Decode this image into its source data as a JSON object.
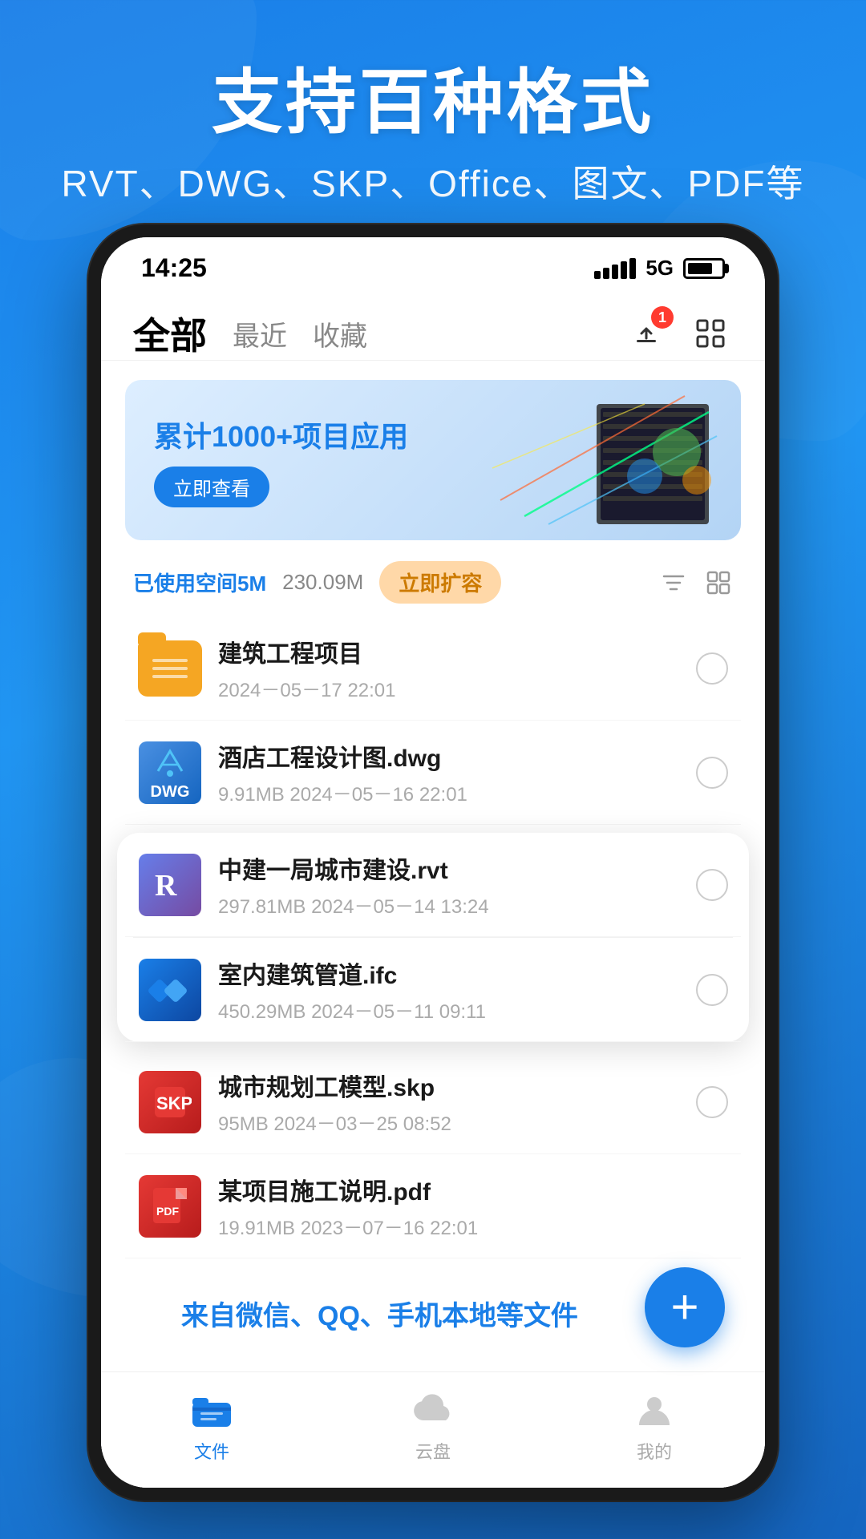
{
  "hero": {
    "title": "支持百种格式",
    "subtitle": "RVT、DWG、SKP、Office、图文、PDF等"
  },
  "status_bar": {
    "time": "14:25",
    "network": "5G",
    "badge_count": "1"
  },
  "nav_tabs": {
    "all": "全部",
    "recent": "最近",
    "favorites": "收藏"
  },
  "banner": {
    "title": "累计1000+项目应用",
    "button": "立即查看"
  },
  "storage": {
    "used_label": "已使用空间5M",
    "separator": "/",
    "total": "230.09M",
    "expand_btn": "立即扩容"
  },
  "files": [
    {
      "name": "建筑工程项目",
      "type": "folder",
      "meta": "2024－05－17 22:01"
    },
    {
      "name": "酒店工程设计图.dwg",
      "type": "dwg",
      "meta": "9.91MB   2024－05－16 22:01"
    },
    {
      "name": "中建一局城市建设.rvt",
      "type": "rvt",
      "meta": "297.81MB   2024－05－14 13:24"
    },
    {
      "name": "室内建筑管道.ifc",
      "type": "ifc",
      "meta": "450.29MB   2024－05－11 09:11"
    },
    {
      "name": "城市规划工模型.skp",
      "type": "skp",
      "meta": "95MB   2024－03－25 08:52"
    },
    {
      "name": "某项目施工说明.pdf",
      "type": "pdf",
      "meta": "19.91MB   2023－07－16 22:01"
    }
  ],
  "bottom_hint": "来自微信、QQ、手机本地等文件",
  "bottom_nav": [
    {
      "label": "文件",
      "active": true
    },
    {
      "label": "云盘",
      "active": false
    },
    {
      "label": "我的",
      "active": false
    }
  ],
  "fab": "+"
}
